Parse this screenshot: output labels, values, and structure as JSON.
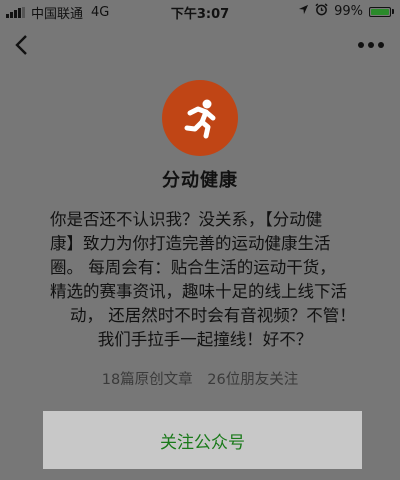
{
  "status_bar": {
    "carrier": "中国联通",
    "network": "4G",
    "time": "下午3:07",
    "battery": "99%",
    "battery_level": 0.99,
    "icons": [
      "signal-icon",
      "location-icon",
      "alarm-icon",
      "battery-icon"
    ]
  },
  "nav": {
    "back_icon": "chevron-left-icon",
    "more_icon": "more-dots-icon"
  },
  "account": {
    "name": "分动健康",
    "logo_icon": "running-person-icon",
    "logo_color": "#c04515",
    "intro_lines": [
      "你是否还不认识我？没关系，【分动健",
      "康】致力为你打造完善的运动健康生活",
      "圈。 每周会有：贴合生活的运动干货，",
      "精选的赛事资讯，趣味十足的线上线下活",
      "动， 还居然时不时会有音视频？不管！",
      "我们手拉手一起撞线！好不？"
    ],
    "articles": "18篇原创文章",
    "friends": "26位朋友关注"
  },
  "follow_button": {
    "label": "关注公众号",
    "color": "#1a7a1a"
  }
}
